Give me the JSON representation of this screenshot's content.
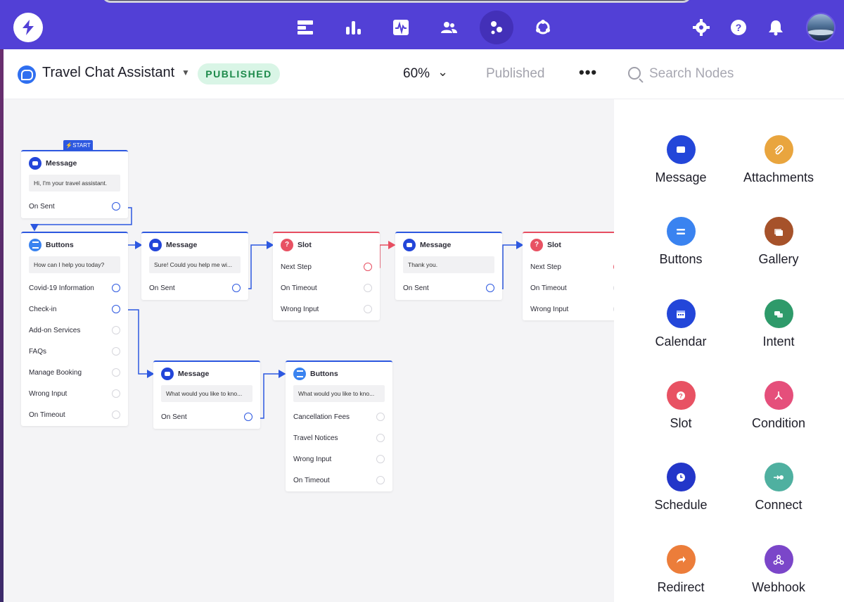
{
  "colors": {
    "nav": "#5240d6",
    "accent_blue": "#2d58e0",
    "slot_red": "#e74e61",
    "published_green": "#1d8a4b"
  },
  "nav_icons": [
    "logo-icon",
    "kanban-icon",
    "bar-chart-icon",
    "activity-icon",
    "users-icon",
    "flow-icon",
    "sync-icon",
    "gear-icon",
    "help-icon",
    "bell-icon",
    "avatar"
  ],
  "header": {
    "title": "Travel Chat Assistant",
    "badge": "PUBLISHED",
    "zoom": "60%",
    "status": "Published",
    "more": "•••"
  },
  "search": {
    "placeholder": "Search Nodes"
  },
  "canvas": {
    "start_label": "⚡START",
    "nodes": {
      "n1": {
        "type": "Message",
        "text": "Hi, I'm your travel assistant.",
        "ports": [
          "On Sent"
        ]
      },
      "n2": {
        "type": "Buttons",
        "text": "How can I help you today?",
        "ports": [
          "Covid-19 Information",
          "Check-in",
          "Add-on Services",
          "FAQs",
          "Manage Booking",
          "Wrong Input",
          "On Timeout"
        ]
      },
      "n3": {
        "type": "Message",
        "text": "Sure! Could you help me wi...",
        "ports": [
          "On Sent"
        ]
      },
      "n4": {
        "type": "Slot",
        "ports": [
          "Next Step",
          "On Timeout",
          "Wrong Input"
        ]
      },
      "n5": {
        "type": "Message",
        "text": "Thank you.",
        "ports": [
          "On Sent"
        ]
      },
      "n6": {
        "type": "Slot",
        "ports": [
          "Next Step",
          "On Timeout",
          "Wrong Input"
        ]
      },
      "n7": {
        "type": "Message",
        "text": "What would you like to kno...",
        "ports": [
          "On Sent"
        ]
      },
      "n8": {
        "type": "Buttons",
        "text": "What would you like to kno...",
        "ports": [
          "Cancellation Fees",
          "Travel Notices",
          "Wrong Input",
          "On Timeout"
        ]
      }
    }
  },
  "palette": [
    {
      "label": "Message",
      "color": "#2346d9",
      "icon": "message-icon"
    },
    {
      "label": "Attachments",
      "color": "#e9a53e",
      "icon": "paperclip-icon"
    },
    {
      "label": "Buttons",
      "color": "#3a83f0",
      "icon": "buttons-icon"
    },
    {
      "label": "Gallery",
      "color": "#a6522a",
      "icon": "gallery-icon"
    },
    {
      "label": "Calendar",
      "color": "#2346d9",
      "icon": "calendar-icon"
    },
    {
      "label": "Intent",
      "color": "#2e9a6a",
      "icon": "intent-icon"
    },
    {
      "label": "Slot",
      "color": "#e85263",
      "icon": "question-icon"
    },
    {
      "label": "Condition",
      "color": "#e54f7b",
      "icon": "branch-icon"
    },
    {
      "label": "Schedule",
      "color": "#2336c9",
      "icon": "clock-icon"
    },
    {
      "label": "Connect",
      "color": "#4fb0a0",
      "icon": "connect-icon"
    },
    {
      "label": "Redirect",
      "color": "#ec7d3a",
      "icon": "redirect-icon"
    },
    {
      "label": "Webhook",
      "color": "#7b46c9",
      "icon": "webhook-icon"
    }
  ]
}
